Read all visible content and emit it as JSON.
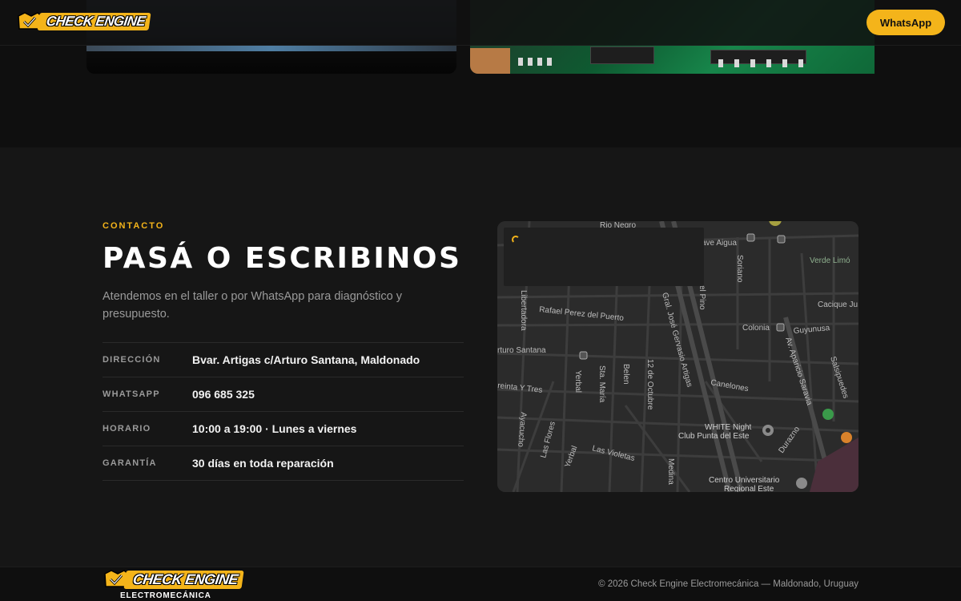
{
  "header": {
    "logo_text": "CHECK ENGINE",
    "whatsapp_label": "WhatsApp"
  },
  "contact": {
    "eyebrow": "CONTACTO",
    "title": "PASÁ O ESCRIBINOS",
    "subtitle": "Atendemos en el taller o por WhatsApp para diagnóstico y presupuesto.",
    "rows": [
      {
        "label": "DIRECCIÓN",
        "value": "Bvar. Artigas c/Arturo Santana, Maldonado"
      },
      {
        "label": "WHATSAPP",
        "value": "096 685 325"
      },
      {
        "label": "HORARIO",
        "value": "10:00 a 19:00 · Lunes a viernes"
      },
      {
        "label": "GARANTÍA",
        "value": "30 días en toda reparación"
      }
    ]
  },
  "map": {
    "streets": {
      "rio_negro": "Rio Negro",
      "ave_aigua": "ave Aigua",
      "verde_limon": "Verde Limó",
      "soriano": "Soriano",
      "del_pino": "el Pino",
      "libertadora": "Libertadora",
      "rafael_perez": "Rafael Perez del Puerto",
      "artigas": "Gral. José Gervasio Artigas",
      "cacique": "Cacique Ju",
      "colonia": "Colonia",
      "guyunusa": "Guyunusa",
      "arturo_santana": "rturo Santana",
      "aparicio": "Av. Aparicio Saravia",
      "salsipuedes": "Salsipuedes",
      "treinta_tres": "reinta Y Tres",
      "yerbal": "Yerbal",
      "sta_maria": "Sta. María",
      "belen": "Belen",
      "doce_octubre": "12 de Octubre",
      "canelones": "Canelones",
      "ayacucho": "Ayacucho",
      "las_flores": "Las Flores",
      "yerbal_2": "Yerbal",
      "las_violetas": "Las Violetas",
      "durazno": "Durazno",
      "medina": "Medina",
      "white_night": "WHITE Night",
      "club_punta": "Club Punta del Este",
      "centro_univ": "Centro Universitario",
      "regional_este": "Regional Este"
    }
  },
  "footer": {
    "logo_text": "CHECK ENGINE",
    "logo_sub": "ELECTROMECÁNICA",
    "copyright": "© 2026 Check Engine Electromecánica — Maldonado, Uruguay"
  },
  "colors": {
    "accent": "#f4b41a",
    "background": "#0f0f0f",
    "section": "#161616"
  }
}
